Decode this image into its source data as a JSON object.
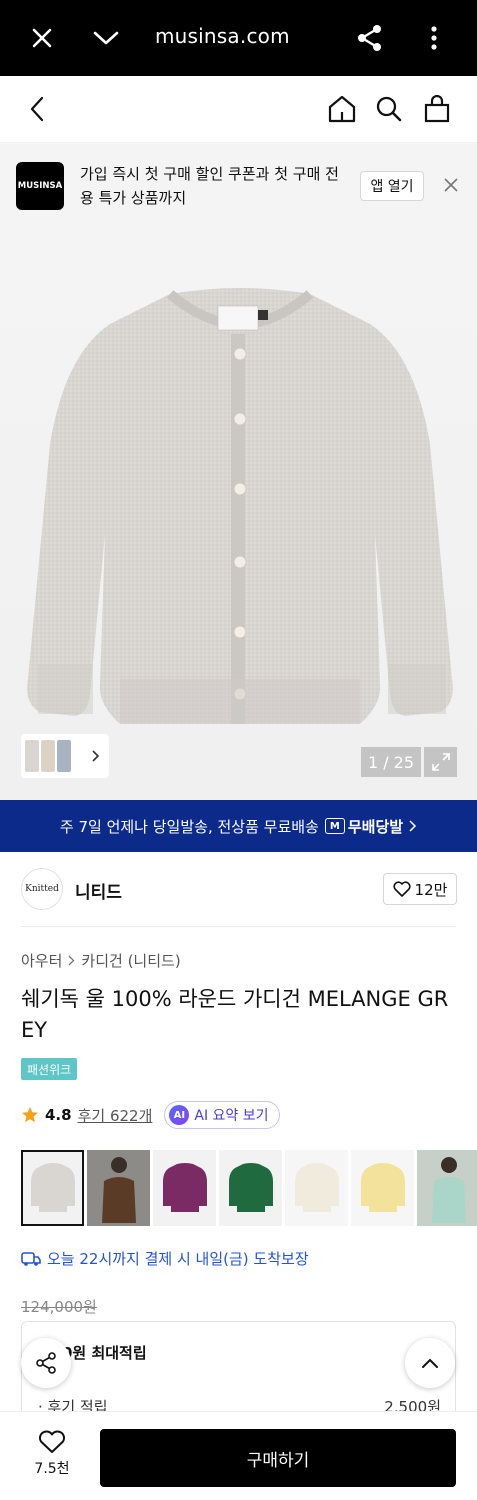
{
  "browser": {
    "url": "musinsa.com",
    "icons": [
      "close-icon",
      "chevron-down-icon",
      "share-icon",
      "more-vert-icon"
    ]
  },
  "header": {
    "icons": [
      "back-arrow-icon",
      "home-icon",
      "search-icon",
      "bag-icon"
    ]
  },
  "app_banner": {
    "logo_text": "MUSINSA",
    "message": "가입 즉시 첫 구매 할인 쿠폰과 첫 구매 전용 특가 상품까지",
    "open_label": "앱 열기"
  },
  "gallery": {
    "counter": "1 / 25"
  },
  "promo": {
    "text": "주 7일 언제나 당일발송, 전상품 무료배송",
    "badge_mark": "M",
    "badge_label": "무배당발"
  },
  "brand": {
    "logo_text": "Knitted",
    "name": "니티드",
    "likes": "12만"
  },
  "product": {
    "breadcrumb": [
      "아우터",
      "카디건 (니티드)"
    ],
    "title": "쉐기독 울 100% 라운드 가디건 MELANGE GREY",
    "tag": "패션위크",
    "rating": "4.8",
    "reviews": "후기 622개",
    "ai_mark": "AI",
    "ai_label": "AI 요약 보기",
    "swatches": [
      {
        "name": "melange-grey",
        "color": "#d9d6d2"
      },
      {
        "name": "brown-model",
        "color": "#5a3b26"
      },
      {
        "name": "purple",
        "color": "#7a2b63"
      },
      {
        "name": "green",
        "color": "#1f6b3f"
      },
      {
        "name": "ivory",
        "color": "#f1ebde"
      },
      {
        "name": "yellow",
        "color": "#f3e39a"
      },
      {
        "name": "mint-model",
        "color": "#a9d6c9"
      }
    ],
    "delivery": "오늘 22시까지 결제 시 내일(금) 도착보장",
    "original_price": "124,000원",
    "points_title": "0원 최대적립",
    "points_row_label": "· 후기 적립",
    "points_row_value": "2,500원"
  },
  "bottom_bar": {
    "wish_count": "7.5천",
    "buy_label": "구매하기"
  },
  "colors": {
    "promo_bg": "#0b2a8a",
    "delivery_blue": "#2454d6",
    "tag_bg": "#5ec6c6",
    "ai_purple": "#4b3bd6"
  }
}
